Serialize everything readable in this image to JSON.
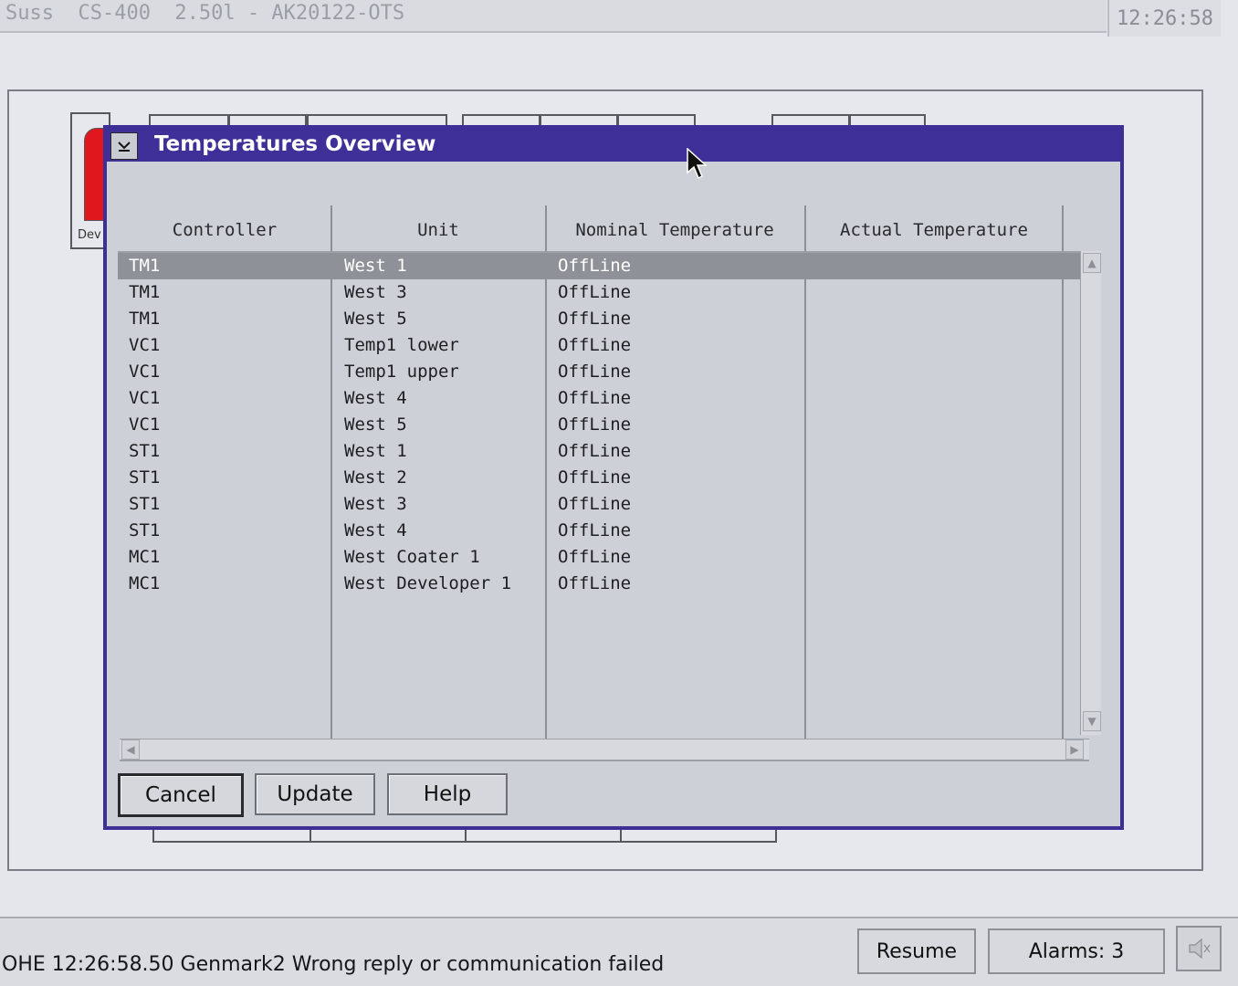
{
  "window": {
    "title": "Suss  CS-400  2.50l - AK20122-OTS",
    "clock": "12:26:58"
  },
  "background": {
    "device_label": "Dev"
  },
  "dialog": {
    "title": "Temperatures Overview",
    "columns": [
      "Controller",
      "Unit",
      "Nominal Temperature",
      "Actual Temperature"
    ],
    "rows": [
      {
        "controller": "TM1",
        "unit": "West 1",
        "nominal": "OffLine",
        "actual": "",
        "selected": true
      },
      {
        "controller": "TM1",
        "unit": "West 3",
        "nominal": "OffLine",
        "actual": ""
      },
      {
        "controller": "TM1",
        "unit": "West 5",
        "nominal": "OffLine",
        "actual": ""
      },
      {
        "controller": "VC1",
        "unit": "Temp1 lower",
        "nominal": "OffLine",
        "actual": ""
      },
      {
        "controller": "VC1",
        "unit": "Temp1 upper",
        "nominal": "OffLine",
        "actual": ""
      },
      {
        "controller": "VC1",
        "unit": "West 4",
        "nominal": "OffLine",
        "actual": ""
      },
      {
        "controller": "VC1",
        "unit": "West 5",
        "nominal": "OffLine",
        "actual": ""
      },
      {
        "controller": "ST1",
        "unit": "West 1",
        "nominal": "OffLine",
        "actual": ""
      },
      {
        "controller": "ST1",
        "unit": "West 2",
        "nominal": "OffLine",
        "actual": ""
      },
      {
        "controller": "ST1",
        "unit": "West 3",
        "nominal": "OffLine",
        "actual": ""
      },
      {
        "controller": "ST1",
        "unit": "West 4",
        "nominal": "OffLine",
        "actual": ""
      },
      {
        "controller": "MC1",
        "unit": "West Coater 1",
        "nominal": "OffLine",
        "actual": ""
      },
      {
        "controller": "MC1",
        "unit": "West Developer 1",
        "nominal": "OffLine",
        "actual": ""
      }
    ],
    "buttons": {
      "cancel": "Cancel",
      "update": "Update",
      "help": "Help"
    }
  },
  "status_bar": {
    "message": "OHE 12:26:58.50 Genmark2 Wrong reply or communication failed",
    "resume_label": "Resume",
    "alarms_label": "Alarms: 3"
  },
  "icons": {
    "system_menu": "chevron-down-icon",
    "scroll_up": "arrow-up-icon",
    "scroll_down": "arrow-down-icon",
    "scroll_left": "arrow-left-icon",
    "scroll_right": "arrow-right-icon",
    "speaker": "speaker-mute-icon",
    "cursor": "mouse-pointer-icon"
  },
  "colors": {
    "dialog_title_bar": "#3f2f98",
    "selected_row": "#8e9197",
    "device_indicator": "#e0171c"
  }
}
